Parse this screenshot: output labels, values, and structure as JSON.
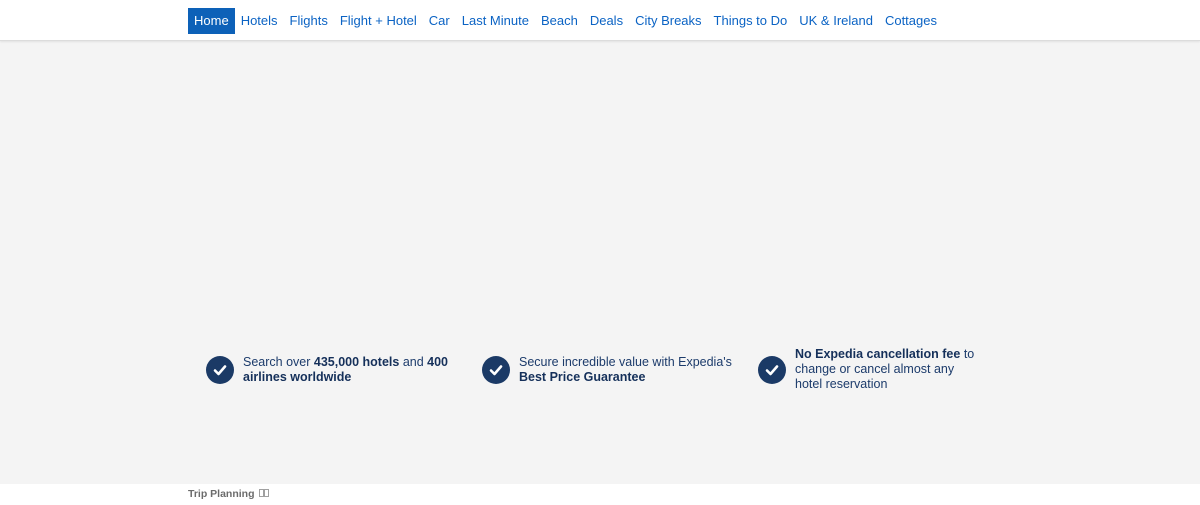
{
  "nav": {
    "items": [
      {
        "label": "Home",
        "active": true
      },
      {
        "label": "Hotels",
        "active": false
      },
      {
        "label": "Flights",
        "active": false
      },
      {
        "label": "Flight + Hotel",
        "active": false
      },
      {
        "label": "Car",
        "active": false
      },
      {
        "label": "Last Minute",
        "active": false
      },
      {
        "label": "Beach",
        "active": false
      },
      {
        "label": "Deals",
        "active": false
      },
      {
        "label": "City Breaks",
        "active": false
      },
      {
        "label": "Things to Do",
        "active": false
      },
      {
        "label": "UK & Ireland",
        "active": false
      },
      {
        "label": "Cottages",
        "active": false
      }
    ]
  },
  "features": [
    {
      "icon": "check-circle-icon",
      "t1": "Search over ",
      "b1": "435,000 hotels",
      "t2": " and ",
      "b2": "400 airlines worldwide",
      "t3": ""
    },
    {
      "icon": "check-circle-icon",
      "t1": "Secure incredible value with Expedia's ",
      "b1": "Best Price Guarantee",
      "t2": "",
      "b2": "",
      "t3": ""
    },
    {
      "icon": "check-circle-icon",
      "t1": "",
      "b1": "No Expedia cancellation fee",
      "t2": " to change or cancel almost any hotel reservation",
      "b2": "",
      "t3": ""
    }
  ],
  "footer": {
    "trip_planning": "Trip Planning",
    "trip_icon": "external-link-icon"
  },
  "colors": {
    "nav_link": "#0b63c4",
    "nav_active_bg": "#0d61b8",
    "check_bg": "#1b3a66",
    "main_bg": "#f4f4f4"
  }
}
